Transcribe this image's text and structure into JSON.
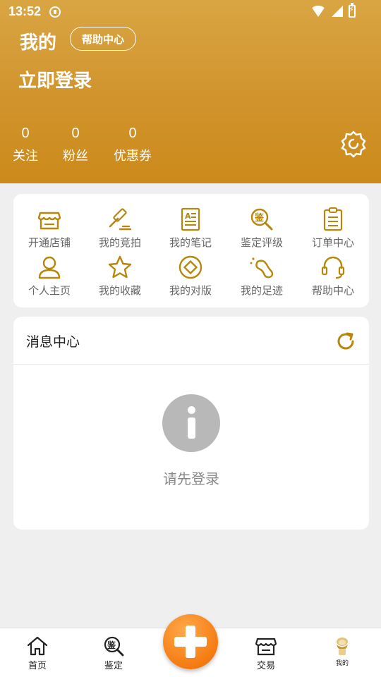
{
  "status_bar": {
    "time": "13:52"
  },
  "header": {
    "title": "我的",
    "help_button": "帮助中心",
    "login_link": "立即登录",
    "stats": [
      {
        "value": "0",
        "label": "关注"
      },
      {
        "value": "0",
        "label": "粉丝"
      },
      {
        "value": "0",
        "label": "优惠券"
      }
    ],
    "settings_icon": "gear-icon"
  },
  "menu_grid": {
    "items": [
      {
        "label": "开通店铺",
        "icon": "shop-icon"
      },
      {
        "label": "我的竞拍",
        "icon": "gavel-icon"
      },
      {
        "label": "我的笔记",
        "icon": "note-icon"
      },
      {
        "label": "鉴定评级",
        "icon": "appraise-icon"
      },
      {
        "label": "订单中心",
        "icon": "clipboard-icon"
      },
      {
        "label": "个人主页",
        "icon": "person-icon"
      },
      {
        "label": "我的收藏",
        "icon": "star-icon"
      },
      {
        "label": "我的对版",
        "icon": "coin-icon"
      },
      {
        "label": "我的足迹",
        "icon": "footprint-icon"
      },
      {
        "label": "帮助中心",
        "icon": "headset-icon"
      }
    ]
  },
  "message_center": {
    "title": "消息中心",
    "empty_text": "请先登录"
  },
  "tab_bar": {
    "tabs": [
      {
        "label": "首页",
        "icon": "home-icon"
      },
      {
        "label": "鉴定",
        "icon": "appraise-icon"
      },
      {
        "label": "交易",
        "icon": "shop-icon"
      },
      {
        "label": "我的",
        "icon": "avatar-icon"
      }
    ],
    "center_action_icon": "plus-icon"
  },
  "colors": {
    "header_top": "#d9a543",
    "header_bottom": "#cc8a1a",
    "icon_gold": "#b8860b",
    "fab_orange": "#f57b12"
  }
}
